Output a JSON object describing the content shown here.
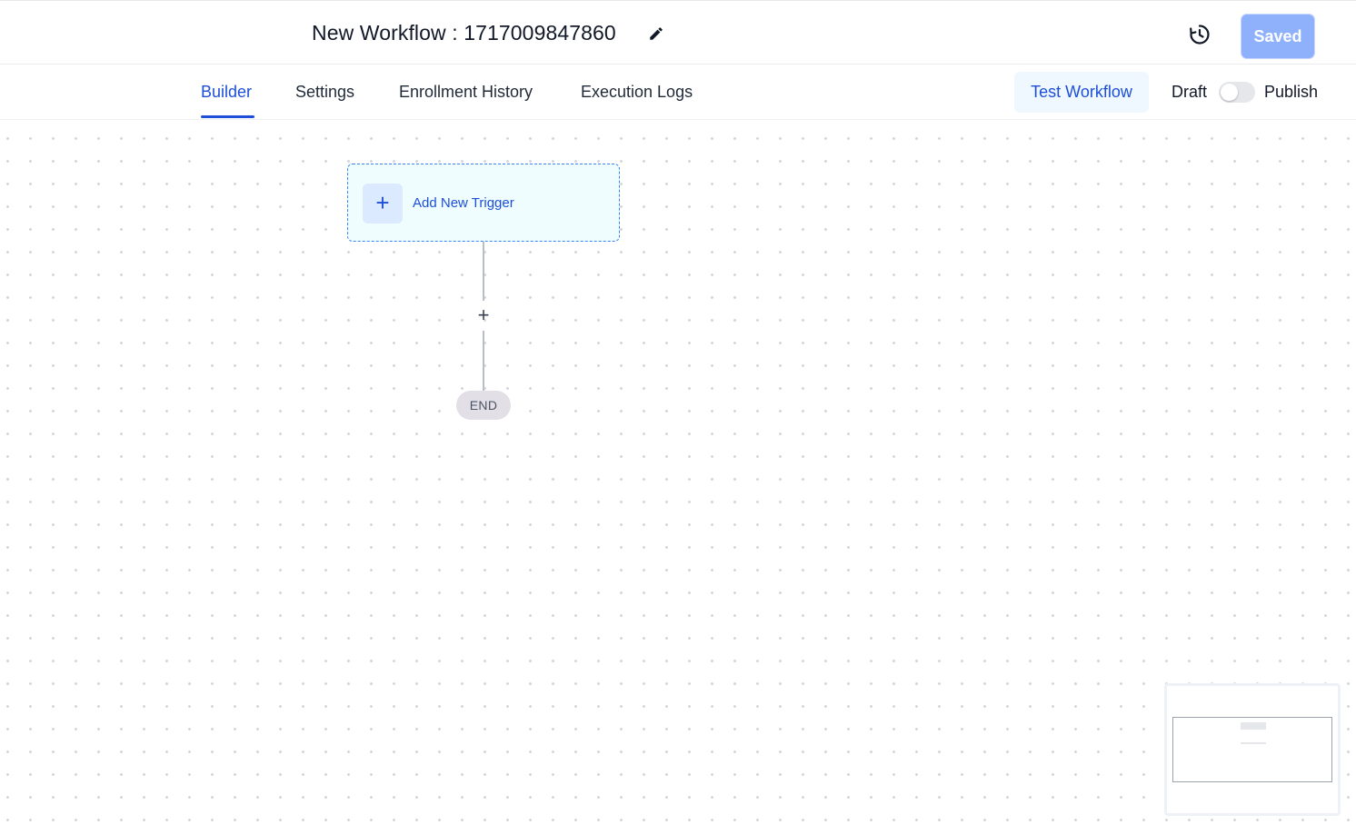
{
  "header": {
    "workflow_title": "New Workflow : 1717009847860",
    "edit_icon": "pencil-icon",
    "history_icon": "history-icon",
    "saved_label": "Saved"
  },
  "tabs": [
    {
      "label": "Builder",
      "active": true
    },
    {
      "label": "Settings",
      "active": false
    },
    {
      "label": "Enrollment History",
      "active": false
    },
    {
      "label": "Execution Logs",
      "active": false
    }
  ],
  "actions": {
    "test_workflow_label": "Test Workflow",
    "draft_label": "Draft",
    "publish_label": "Publish",
    "publish_toggle_on": false
  },
  "canvas": {
    "trigger_label": "Add New Trigger",
    "trigger_icon": "plus-icon",
    "add_step_icon": "plus-icon",
    "end_label": "END"
  },
  "colors": {
    "accent": "#1d4ed8",
    "saved_button": "#8fb1fb",
    "trigger_bg": "#effdff",
    "end_node_bg": "#e2dfe6"
  }
}
